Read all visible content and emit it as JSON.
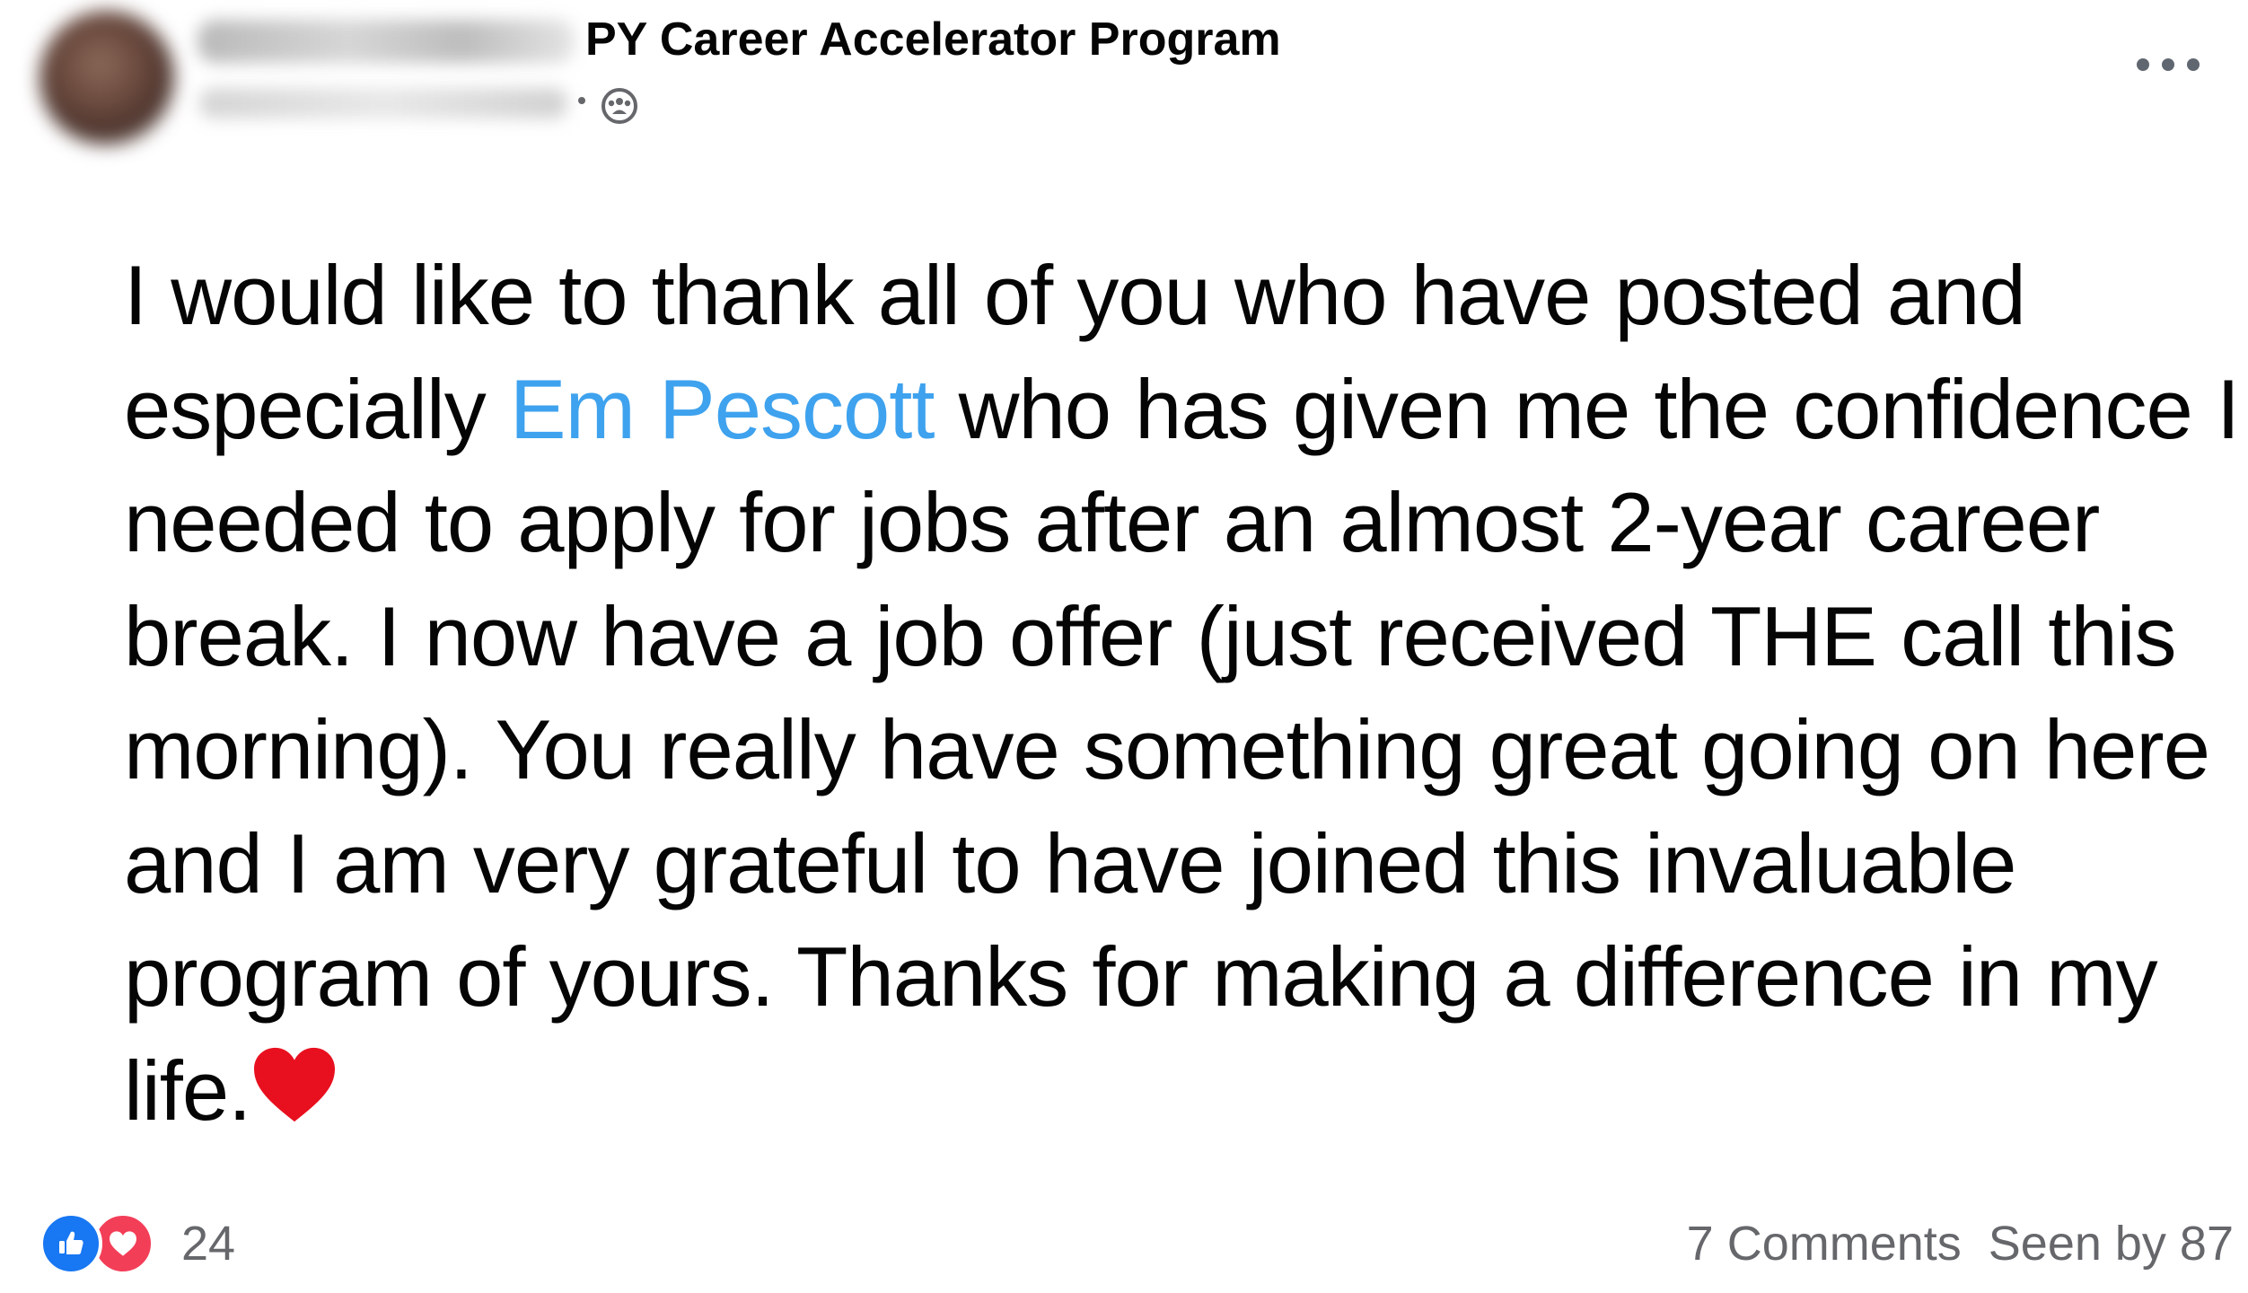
{
  "header": {
    "group_name": "PY Career Accelerator Program",
    "group_icon": "group-icon",
    "more_icon": "more-horizontal-icon"
  },
  "post": {
    "lines": [
      {
        "before": "I would like to thank all of you who have posted and"
      },
      {
        "before": "especially ",
        "mention": "Em Pescott",
        "after": " who has given me the confidence I"
      },
      {
        "before": "needed to apply for jobs after an almost 2-year career"
      },
      {
        "before": "break.  I now have a job offer (just received THE call this"
      },
      {
        "before": "morning).  You really have something great going on here"
      },
      {
        "before": "and I am very grateful to have joined this invaluable"
      },
      {
        "before": "program of yours.  Thanks for making a difference in my"
      },
      {
        "before": "life.",
        "emoji": "red-heart-icon"
      }
    ]
  },
  "footer": {
    "reaction_icons": [
      "like-icon",
      "love-icon"
    ],
    "reaction_count": "24",
    "comments": "7 Comments",
    "seen_by": "Seen by 87"
  },
  "colors": {
    "mention": "#3ea2ee",
    "like": "#1877f2",
    "love": "#f33e58",
    "heart": "#e8101f",
    "secondary_text": "#65676b"
  }
}
